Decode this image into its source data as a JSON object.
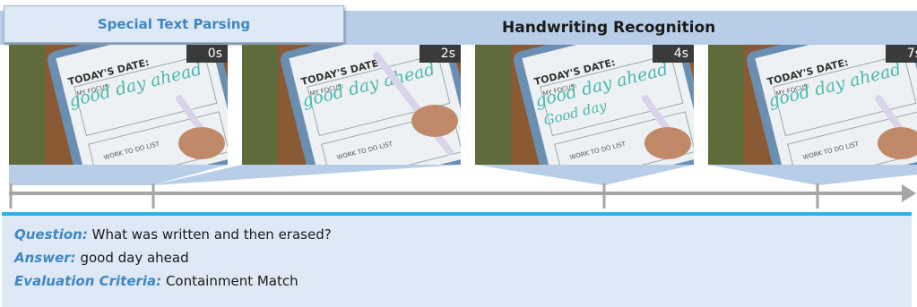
{
  "header": {
    "special_label": "Special Text Parsing",
    "title": "Handwriting Recognition"
  },
  "frames": [
    {
      "time": "0s",
      "title_text": "TODAY'S DATE:",
      "focus_label": "MY FOCUS:",
      "todo_label": "WORK TO DO LIST",
      "writing": [
        "good day ahead"
      ]
    },
    {
      "time": "2s",
      "title_text": "TODAY'S DATE:",
      "focus_label": "MY FOCUS:",
      "todo_label": "WORK TO DO LIST",
      "writing": [
        "good day ahead"
      ]
    },
    {
      "time": "4s",
      "title_text": "TODAY'S DATE:",
      "focus_label": "MY FOCUS:",
      "todo_label": "WORK TO DO LIST",
      "writing": [
        "good day ahead",
        "Good day"
      ]
    },
    {
      "time": "7s",
      "title_text": "TODAY'S DATE:",
      "focus_label": "MY FOCUS:",
      "todo_label": "WORK TO DO LIST",
      "writing": [
        "good day ahead"
      ]
    }
  ],
  "qa": {
    "question_label": "Question:",
    "question": "What was written and then erased?",
    "answer_label": "Answer:",
    "answer": "good day ahead",
    "criteria_label": "Evaluation Criteria:",
    "criteria": "Containment Match"
  },
  "colors": {
    "accent": "#3f87c4",
    "header_band": "#b7cde8",
    "qa_border": "#29b3e8",
    "handwriting": "#4bb8b0"
  }
}
